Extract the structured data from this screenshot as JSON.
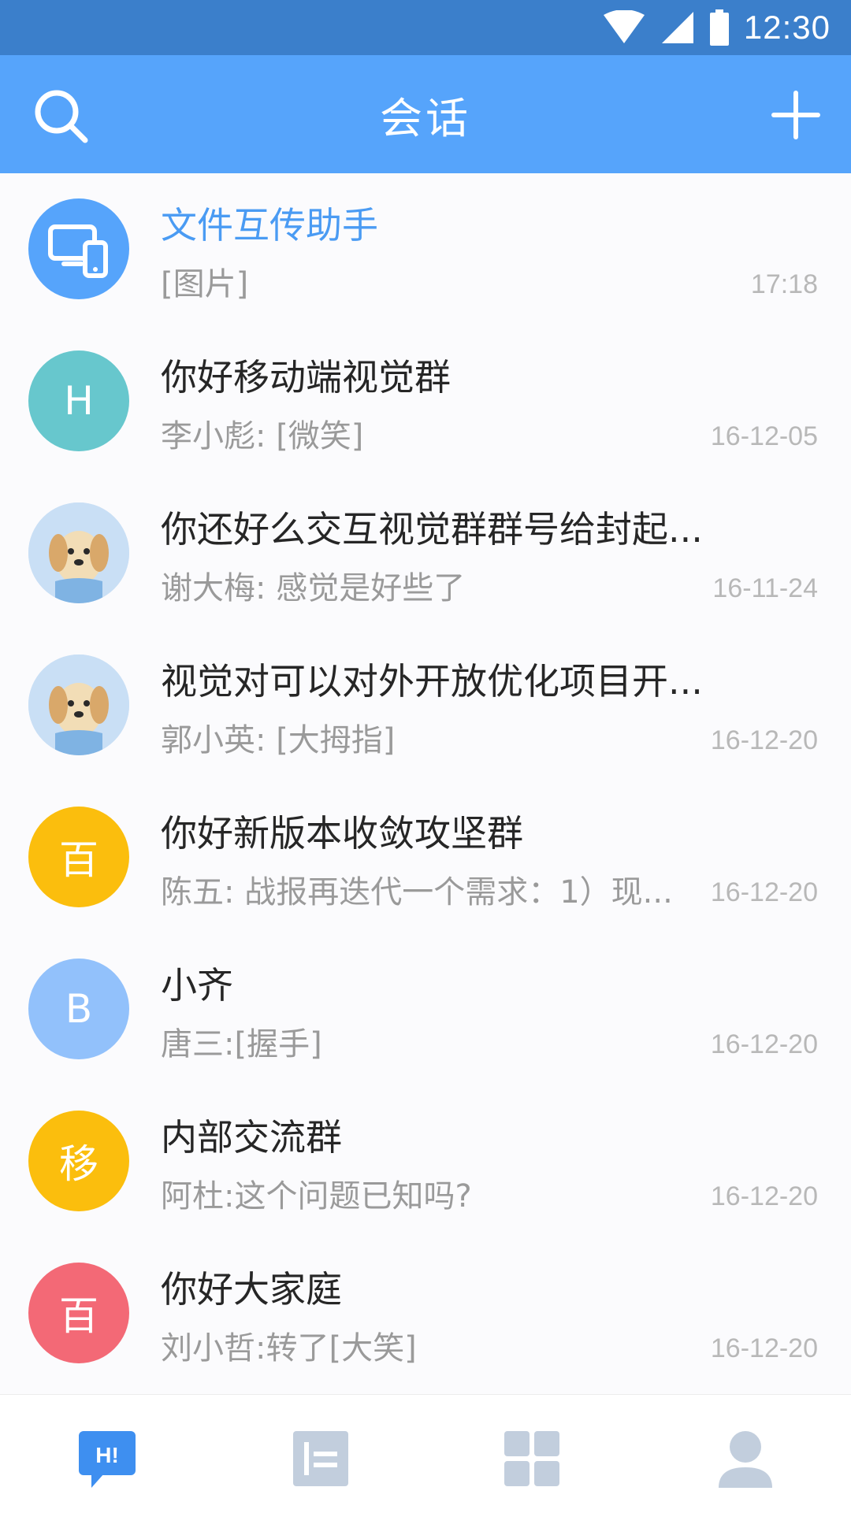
{
  "status_bar": {
    "time": "12:30",
    "icons": [
      "wifi-icon",
      "cell-signal-icon",
      "battery-icon"
    ]
  },
  "header": {
    "title": "会话",
    "left_icon": "search-icon",
    "right_icon": "plus-icon"
  },
  "colors": {
    "status_bar": "#3b7fcb",
    "header": "#56a4fb",
    "accent": "#4a9bf3",
    "teal": "#67c7cd",
    "yellow": "#fbbe0d",
    "light_blue": "#92c1fb",
    "red": "#f36976"
  },
  "conversations": [
    {
      "title": "文件互传助手",
      "preview": "[图片]",
      "time": "17:18",
      "avatar_type": "device-icon",
      "avatar_color": "#56a4fb",
      "accent": true
    },
    {
      "title": "你好移动端视觉群",
      "preview": "李小彪: [微笑]",
      "time": "16-12-05",
      "avatar_text": "H",
      "avatar_color": "#67c7cd"
    },
    {
      "title": "你还好么交互视觉群群号给封起...",
      "preview": "谢大梅: 感觉是好些了",
      "time": "16-11-24",
      "avatar_type": "puppy-photo"
    },
    {
      "title": "视觉对可以对外开放优化项目开...",
      "preview": "郭小英: [大拇指]",
      "time": "16-12-20",
      "avatar_type": "puppy-photo"
    },
    {
      "title": "你好新版本收敛攻坚群",
      "preview": "陈五: 战报再迭代一个需求：1）现...",
      "time": "16-12-20",
      "avatar_text": "百",
      "avatar_color": "#fbbe0d"
    },
    {
      "title": "小齐",
      "preview": "唐三:[握手]",
      "time": "16-12-20",
      "avatar_text": "B",
      "avatar_color": "#92c1fb"
    },
    {
      "title": "内部交流群",
      "preview": "阿杜:这个问题已知吗?",
      "time": "16-12-20",
      "avatar_text": "移",
      "avatar_color": "#fbbe0d"
    },
    {
      "title": "你好大家庭",
      "preview": "刘小哲:转了[大笑]",
      "time": "16-12-20",
      "avatar_text": "百",
      "avatar_color": "#f36976"
    }
  ],
  "tabs": [
    {
      "icon": "chat-icon",
      "label": "H!",
      "active": true
    },
    {
      "icon": "document-icon",
      "active": false
    },
    {
      "icon": "apps-grid-icon",
      "active": false
    },
    {
      "icon": "profile-icon",
      "active": false
    }
  ]
}
